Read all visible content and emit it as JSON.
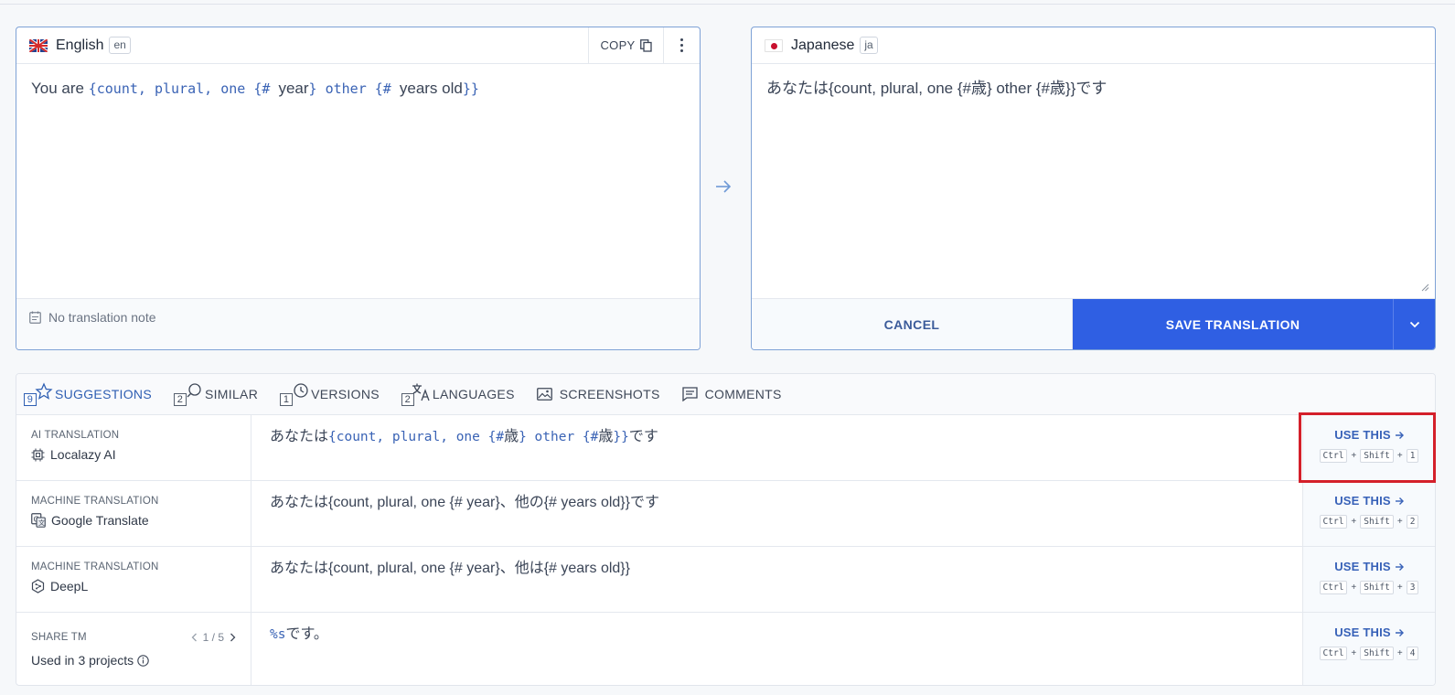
{
  "source": {
    "language": "English",
    "code": "en",
    "copy_label": "COPY",
    "text_prefix": "You are ",
    "tokens": {
      "open": "{count, plural, one {# ",
      "year": "year",
      "mid": "} other {# ",
      "years_old": "years old",
      "close": "}}"
    },
    "note": "No translation note"
  },
  "target": {
    "language": "Japanese",
    "code": "ja",
    "text": "あなたは{count, plural, one {#歳} other {#歳}}です",
    "cancel_label": "CANCEL",
    "save_label": "SAVE TRANSLATION"
  },
  "tabs": [
    {
      "label": "SUGGESTIONS",
      "count": "9"
    },
    {
      "label": "SIMILAR",
      "count": "2"
    },
    {
      "label": "VERSIONS",
      "count": "1"
    },
    {
      "label": "LANGUAGES",
      "count": "2"
    },
    {
      "label": "SCREENSHOTS"
    },
    {
      "label": "COMMENTS"
    }
  ],
  "suggestions": [
    {
      "type": "AI TRANSLATION",
      "engine": "Localazy AI",
      "text_prefix": "あなたは",
      "text_code1": "{count, plural, one {#",
      "text_jp1": "歳",
      "text_code2": "} other {#",
      "text_jp2": "歳",
      "text_code3": "}}",
      "text_suffix": "です",
      "use_label": "USE THIS",
      "shortcut": [
        "Ctrl",
        "Shift",
        "1"
      ]
    },
    {
      "type": "MACHINE TRANSLATION",
      "engine": "Google Translate",
      "text": "あなたは{count, plural, one {# year}、他の{# years old}}です",
      "use_label": "USE THIS",
      "shortcut": [
        "Ctrl",
        "Shift",
        "2"
      ]
    },
    {
      "type": "MACHINE TRANSLATION",
      "engine": "DeepL",
      "text": "あなたは{count, plural, one {# year}、他は{# years old}}",
      "use_label": "USE THIS",
      "shortcut": [
        "Ctrl",
        "Shift",
        "3"
      ]
    },
    {
      "type": "SHARE TM",
      "pager": "1 / 5",
      "used_in_prefix": "Used in",
      "used_in_count": "3 projects",
      "text_code": "%s",
      "text_suffix": "です。",
      "use_label": "USE THIS",
      "shortcut": [
        "Ctrl",
        "Shift",
        "4"
      ]
    }
  ],
  "colors": {
    "accent": "#2f5fe3",
    "link": "#3761b8",
    "highlight": "#d4202a"
  }
}
